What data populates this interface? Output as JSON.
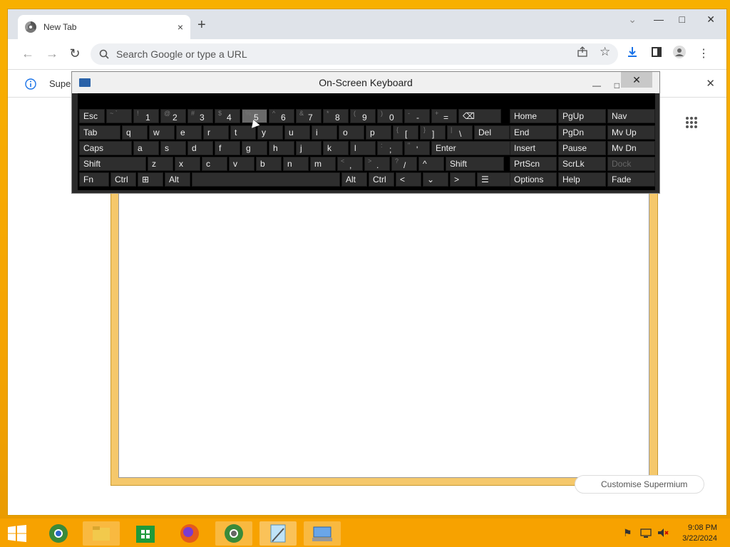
{
  "browser": {
    "tab": {
      "title": "New Tab",
      "close": "×"
    },
    "new_tab": "+",
    "window_controls": {
      "more": "⌄",
      "minimize": "—",
      "maximize": "□",
      "close": "✕"
    },
    "nav": {
      "back": "←",
      "forward": "→",
      "reload": "↻"
    },
    "omnibox": {
      "placeholder": "Search Google or type a URL",
      "search_icon": "search-icon"
    },
    "toolbar_icons": [
      "share-icon",
      "star-icon",
      "download-icon",
      "sidebar-icon",
      "profile-icon",
      "menu-icon"
    ],
    "infobar": {
      "text": "Supe",
      "close": "✕"
    },
    "customise_button": "Customise Supermium"
  },
  "osk": {
    "title": "On-Screen Keyboard",
    "controls": {
      "minimize": "—",
      "maximize": "□",
      "close": "✕"
    },
    "rows": [
      [
        {
          "label": "Esc",
          "sub": ""
        },
        {
          "label": "",
          "sub": "~ `"
        },
        {
          "label": "1",
          "sub": "!"
        },
        {
          "label": "2",
          "sub": "@"
        },
        {
          "label": "3",
          "sub": "#"
        },
        {
          "label": "4",
          "sub": "$"
        },
        {
          "label": "5",
          "sub": "%"
        },
        {
          "label": "6",
          "sub": "^"
        },
        {
          "label": "7",
          "sub": "&"
        },
        {
          "label": "8",
          "sub": "*"
        },
        {
          "label": "9",
          "sub": "("
        },
        {
          "label": "0",
          "sub": ")"
        },
        {
          "label": "-",
          "sub": "-"
        },
        {
          "label": "=",
          "sub": "+"
        },
        {
          "label": "⌫",
          "sub": ""
        }
      ],
      [
        {
          "label": "Tab",
          "sub": ""
        },
        {
          "label": "q",
          "sub": ""
        },
        {
          "label": "w",
          "sub": ""
        },
        {
          "label": "e",
          "sub": ""
        },
        {
          "label": "r",
          "sub": ""
        },
        {
          "label": "t",
          "sub": ""
        },
        {
          "label": "y",
          "sub": ""
        },
        {
          "label": "u",
          "sub": ""
        },
        {
          "label": "i",
          "sub": ""
        },
        {
          "label": "o",
          "sub": ""
        },
        {
          "label": "p",
          "sub": ""
        },
        {
          "label": "[",
          "sub": "{"
        },
        {
          "label": "]",
          "sub": "}"
        },
        {
          "label": "\\",
          "sub": "|"
        },
        {
          "label": "Del",
          "sub": ""
        }
      ],
      [
        {
          "label": "Caps",
          "sub": ""
        },
        {
          "label": "a",
          "sub": ""
        },
        {
          "label": "s",
          "sub": ""
        },
        {
          "label": "d",
          "sub": ""
        },
        {
          "label": "f",
          "sub": ""
        },
        {
          "label": "g",
          "sub": ""
        },
        {
          "label": "h",
          "sub": ""
        },
        {
          "label": "j",
          "sub": ""
        },
        {
          "label": "k",
          "sub": ""
        },
        {
          "label": "l",
          "sub": ""
        },
        {
          "label": ";",
          "sub": ":"
        },
        {
          "label": "'",
          "sub": "\""
        },
        {
          "label": "Enter",
          "sub": ""
        }
      ],
      [
        {
          "label": "Shift",
          "sub": ""
        },
        {
          "label": "z",
          "sub": ""
        },
        {
          "label": "x",
          "sub": ""
        },
        {
          "label": "c",
          "sub": ""
        },
        {
          "label": "v",
          "sub": ""
        },
        {
          "label": "b",
          "sub": ""
        },
        {
          "label": "n",
          "sub": ""
        },
        {
          "label": "m",
          "sub": ""
        },
        {
          "label": ",",
          "sub": "<"
        },
        {
          "label": ".",
          "sub": ">"
        },
        {
          "label": "/",
          "sub": "?"
        },
        {
          "label": "^",
          "sub": ""
        },
        {
          "label": "Shift",
          "sub": ""
        }
      ],
      [
        {
          "label": "Fn",
          "sub": ""
        },
        {
          "label": "Ctrl",
          "sub": ""
        },
        {
          "label": "⊞",
          "sub": ""
        },
        {
          "label": "Alt",
          "sub": ""
        },
        {
          "label": "",
          "sub": ""
        },
        {
          "label": "Alt",
          "sub": ""
        },
        {
          "label": "Ctrl",
          "sub": ""
        },
        {
          "label": "<",
          "sub": ""
        },
        {
          "label": "⌄",
          "sub": ""
        },
        {
          "label": ">",
          "sub": ""
        },
        {
          "label": "☰",
          "sub": ""
        }
      ]
    ],
    "nav": [
      [
        "Home",
        "PgUp",
        "Nav"
      ],
      [
        "End",
        "PgDn",
        "Mv Up"
      ],
      [
        "Insert",
        "Pause",
        "Mv Dn"
      ],
      [
        "PrtScn",
        "ScrLk",
        "Dock"
      ],
      [
        "Options",
        "Help",
        "Fade"
      ]
    ]
  },
  "taskbar": {
    "time": "9:08 PM",
    "date": "3/22/2024"
  }
}
